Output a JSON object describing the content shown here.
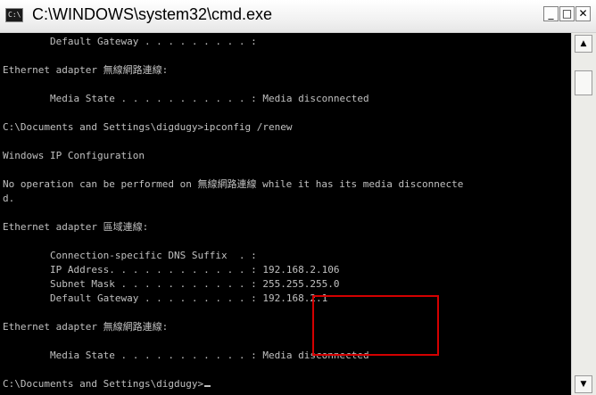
{
  "window": {
    "title": "C:\\WINDOWS\\system32\\cmd.exe",
    "icon_glyph": "C:\\",
    "icon": "console-app-icon",
    "buttons": {
      "minimize": "_",
      "maximize": "□",
      "close": "✕"
    }
  },
  "console": {
    "lines": [
      "        Default Gateway . . . . . . . . . :",
      "",
      "Ethernet adapter 無線網路連線:",
      "",
      "        Media State . . . . . . . . . . . : Media disconnected",
      "",
      "C:\\Documents and Settings\\digdugy>ipconfig /renew",
      "",
      "Windows IP Configuration",
      "",
      "No operation can be performed on 無線網路連線 while it has its media disconnecte",
      "d.",
      "",
      "Ethernet adapter 區域連線:",
      "",
      "        Connection-specific DNS Suffix  . :",
      "        IP Address. . . . . . . . . . . . : 192.168.2.106",
      "        Subnet Mask . . . . . . . . . . . : 255.255.255.0",
      "        Default Gateway . . . . . . . . . : 192.168.2.1",
      "",
      "Ethernet adapter 無線網路連線:",
      "",
      "        Media State . . . . . . . . . . . : Media disconnected",
      "",
      "C:\\Documents and Settings\\digdugy>"
    ],
    "text_color": "#c0c0c0",
    "background": "#000000",
    "highlight_color": "#d40000"
  },
  "scrollbar": {
    "up_arrow": "▲",
    "down_arrow": "▼"
  }
}
